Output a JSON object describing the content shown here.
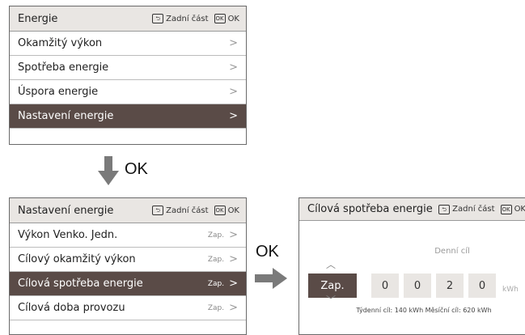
{
  "panel1": {
    "title": "Energie",
    "back_label": "Zadní část",
    "ok_label": "OK",
    "back_key": "⮌",
    "ok_key": "OK",
    "items": [
      {
        "label": "Okamžitý výkon",
        "chev": ">"
      },
      {
        "label": "Spotřeba energie",
        "chev": ">"
      },
      {
        "label": "Úspora energie",
        "chev": ">"
      },
      {
        "label": "Nastavení energie",
        "chev": ">"
      }
    ]
  },
  "arrow_down_label": "OK",
  "panel2": {
    "title": "Nastavení energie",
    "back_label": "Zadní část",
    "ok_label": "OK",
    "items": [
      {
        "label": "Výkon Venko. Jedn.",
        "value": "Zap.",
        "chev": ">"
      },
      {
        "label": "Cílový okamžitý výkon",
        "value": "Zap.",
        "chev": ">"
      },
      {
        "label": "Cílová spotřeba energie",
        "value": "Zap.",
        "chev": ">"
      },
      {
        "label": "Cílová doba provozu",
        "value": "Zap.",
        "chev": ">"
      }
    ]
  },
  "arrow_right_label": "OK",
  "panel3": {
    "title": "Cílová spotřeba energie",
    "back_label": "Zadní část",
    "ok_label": "OK",
    "goal_label": "Denní cíl",
    "toggle": "Zap.",
    "digits": [
      "0",
      "0",
      "2",
      "0"
    ],
    "unit": "kWh",
    "summary": "Týdenní cíl: 140 kWh  Měsíční cíl: 620 kWh"
  },
  "colors": {
    "header_bg": "#e9e6e3",
    "selected_bg": "#5a4b47",
    "border": "#6a6a6a"
  }
}
